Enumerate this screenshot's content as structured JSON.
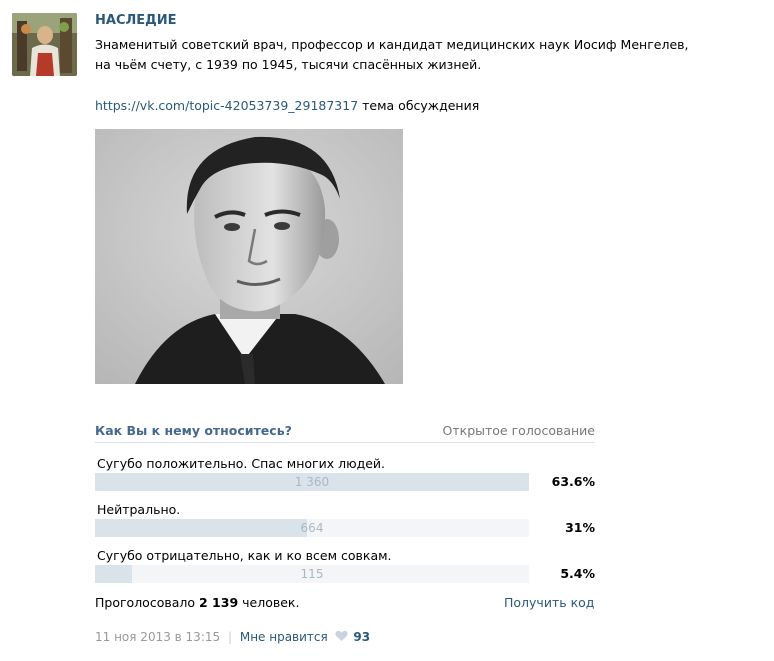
{
  "post": {
    "group_name": "НАСЛЕДИЕ",
    "text": "Знаменитый советский врач, профессор и кандидат медицинских наук Иосиф Менгелев, на чьём счету, с 1939 по 1945, тысячи спасённых жизней.",
    "link_url": "https://vk.com/topic-42053739_29187317",
    "link_suffix": " тема обсуждения"
  },
  "poll": {
    "question": "Как Вы к нему относитесь?",
    "type_label": "Открытое голосование",
    "options": [
      {
        "label": "Сугубо положительно. Спас многих людей.",
        "count": "1 360",
        "percent": "63.6%",
        "fraction": 1.0
      },
      {
        "label": "Нейтрально.",
        "count": "664",
        "percent": "31%",
        "fraction": 0.488
      },
      {
        "label": "Сугубо отрицательно, как и ко всем совкам.",
        "count": "115",
        "percent": "5.4%",
        "fraction": 0.085
      }
    ],
    "total_prefix": "Проголосовало ",
    "total_count": "2 139",
    "total_suffix": " человек.",
    "get_code_label": "Получить код"
  },
  "footer": {
    "date": "11 ноя 2013 в 13:15",
    "separator": "|",
    "like_label": "Мне нравится",
    "like_count": "93"
  },
  "icons": {
    "like": "heart-icon"
  },
  "colors": {
    "link": "#2b587a",
    "poll_question": "#45688e",
    "bar_fill": "#dae2ea",
    "bar_track": "#f3f5f7",
    "muted": "#999999"
  }
}
